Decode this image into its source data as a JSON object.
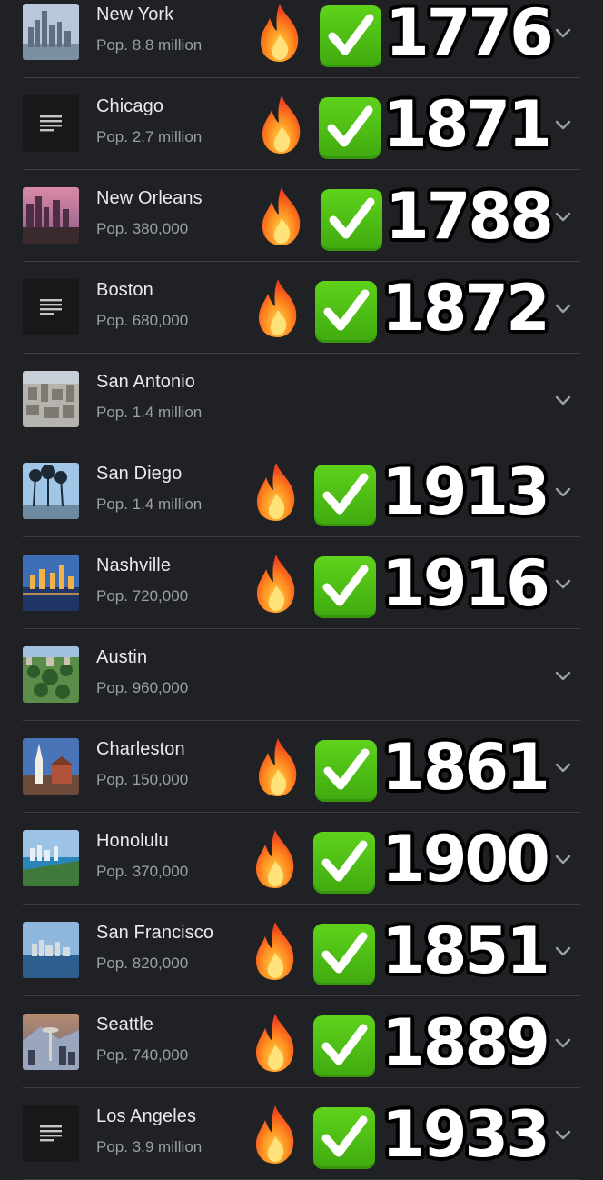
{
  "cities": [
    {
      "name": "New York",
      "population": "Pop. 8.8 million",
      "thumb": "photo-skyline-icon",
      "year": "1776",
      "fire": true,
      "check": true
    },
    {
      "name": "Chicago",
      "population": "Pop. 2.7 million",
      "thumb": "document-icon",
      "year": "1871",
      "fire": true,
      "check": true
    },
    {
      "name": "New Orleans",
      "population": "Pop. 380,000",
      "thumb": "photo-dusk-skyline-icon",
      "year": "1788",
      "fire": true,
      "check": true
    },
    {
      "name": "Boston",
      "population": "Pop. 680,000",
      "thumb": "document-icon",
      "year": "1872",
      "fire": true,
      "check": true
    },
    {
      "name": "San Antonio",
      "population": "Pop. 1.4 million",
      "thumb": "photo-city-aerial-icon",
      "year": "",
      "fire": false,
      "check": false
    },
    {
      "name": "San Diego",
      "population": "Pop. 1.4 million",
      "thumb": "photo-palm-trees-icon",
      "year": "1913",
      "fire": true,
      "check": true
    },
    {
      "name": "Nashville",
      "population": "Pop. 720,000",
      "thumb": "photo-night-river-icon",
      "year": "1916",
      "fire": true,
      "check": true
    },
    {
      "name": "Austin",
      "population": "Pop. 960,000",
      "thumb": "photo-park-aerial-icon",
      "year": "",
      "fire": false,
      "check": false
    },
    {
      "name": "Charleston",
      "population": "Pop. 150,000",
      "thumb": "photo-church-steeple-icon",
      "year": "1861",
      "fire": true,
      "check": true
    },
    {
      "name": "Honolulu",
      "population": "Pop. 370,000",
      "thumb": "photo-coast-icon",
      "year": "1900",
      "fire": true,
      "check": true
    },
    {
      "name": "San Francisco",
      "population": "Pop. 820,000",
      "thumb": "photo-bay-city-icon",
      "year": "1851",
      "fire": true,
      "check": true
    },
    {
      "name": "Seattle",
      "population": "Pop. 740,000",
      "thumb": "photo-space-needle-icon",
      "year": "1889",
      "fire": true,
      "check": true
    },
    {
      "name": "Los Angeles",
      "population": "Pop. 3.9 million",
      "thumb": "document-icon",
      "year": "1933",
      "fire": true,
      "check": true
    }
  ],
  "colors": {
    "background": "#202124",
    "divider": "#3c4043",
    "name_text": "#e8eaed",
    "population_text": "#9aa0a6",
    "check_green": "#4cbf14",
    "chevron": "#9aa0a6"
  }
}
